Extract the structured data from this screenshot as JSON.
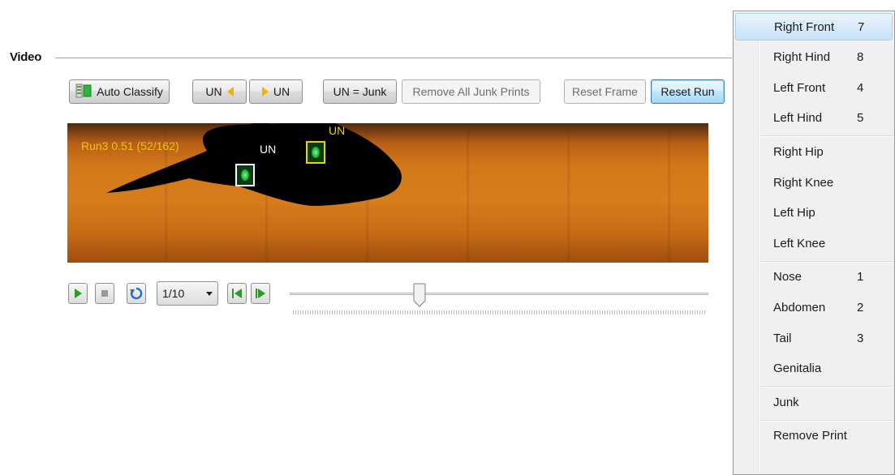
{
  "group": {
    "label": "Video"
  },
  "toolbar": {
    "auto_classify": "Auto Classify",
    "un_left": "UN",
    "un_right": "UN",
    "un_junk": "UN = Junk",
    "remove_junk": "Remove All Junk Prints",
    "reset_frame": "Reset Frame",
    "reset_run": "Reset Run"
  },
  "video": {
    "run_info": "Run3 0.51 (52/162)",
    "label_un_white": "UN",
    "label_un_yellow": "UN"
  },
  "playback": {
    "speed": "1/10",
    "slider_position": 0.31
  },
  "menu": {
    "groups": [
      [
        {
          "label": "Right Front",
          "key": "7"
        },
        {
          "label": "Right Hind",
          "key": "8"
        },
        {
          "label": "Left Front",
          "key": "4"
        },
        {
          "label": "Left Hind",
          "key": "5"
        }
      ],
      [
        {
          "label": "Right Hip",
          "key": ""
        },
        {
          "label": "Right Knee",
          "key": ""
        },
        {
          "label": "Left Hip",
          "key": ""
        },
        {
          "label": "Left Knee",
          "key": ""
        }
      ],
      [
        {
          "label": "Nose",
          "key": "1"
        },
        {
          "label": "Abdomen",
          "key": "2"
        },
        {
          "label": "Tail",
          "key": "3"
        },
        {
          "label": "Genitalia",
          "key": ""
        }
      ],
      [
        {
          "label": "Junk",
          "key": ""
        }
      ],
      [
        {
          "label": "Remove Print",
          "key": ""
        }
      ]
    ]
  },
  "colors": {
    "run_info_text": "#f0c020",
    "label_white": "#ffffff",
    "label_yellow": "#f2d200",
    "print_box_white": "#ffffff",
    "print_box_yellow": "#e8d400",
    "menu_highlight": "#c7e2f8",
    "arrow": "#f0b400"
  }
}
